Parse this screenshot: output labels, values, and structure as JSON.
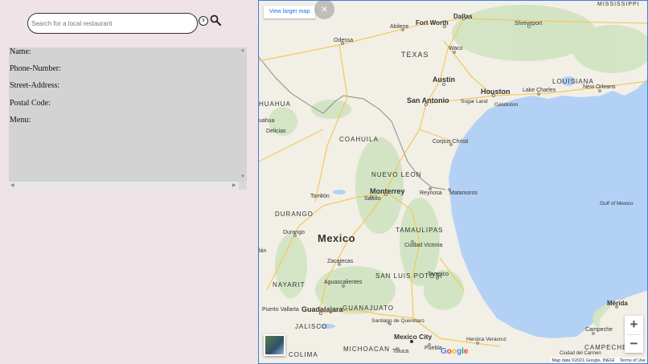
{
  "search": {
    "placeholder": "Search for a local restaurant",
    "value": "",
    "clear_label": "x"
  },
  "details": {
    "fields": [
      {
        "label": "Name:"
      },
      {
        "label": "Phone-Number:"
      },
      {
        "label": "Street-Address:"
      },
      {
        "label": "Postal Code:"
      },
      {
        "label": "Menu:"
      }
    ]
  },
  "map": {
    "view_larger": "View larger map",
    "close": "×",
    "zoom_in": "+",
    "zoom_out": "−",
    "attribution": "Map data ©2021 Google, INEGI",
    "terms": "Terms of Use",
    "google": [
      "G",
      "o",
      "o",
      "g",
      "l",
      "e"
    ],
    "google_colors": [
      "#4285f4",
      "#ea4335",
      "#fbbc05",
      "#4285f4",
      "#34a853",
      "#ea4335"
    ],
    "labels": {
      "mississippi": "MISSISSIPPI",
      "fort_worth": "Fort Worth",
      "dallas": "Dallas",
      "shreveport": "Shreveport",
      "abilene": "Abilene",
      "odessa": "Odessa",
      "texas": "TEXAS",
      "waco": "Waco",
      "louisiana": "LOUISIANA",
      "austin": "Austin",
      "houston": "Houston",
      "lake_charles": "Lake Charles",
      "new_orleans": "New Orleans",
      "sugar_land": "Sugar Land",
      "san_antonio": "San Antonio",
      "galveston": "Galveston",
      "chihuahua_state": "HUAHUA",
      "chihuahua_city": "uahua",
      "delicias": "Delicias",
      "coahuila": "COAHUILA",
      "corpus_christi": "Corpus Christi",
      "nuevo_leon": "NUEVO LEON",
      "monterrey": "Monterrey",
      "torreon": "Torreón",
      "saltillo": "Saltillo",
      "reynosa": "Reynosa",
      "matamoros": "Matamoros",
      "gulf": "Gulf of Mexico",
      "durango_state": "DURANGO",
      "durango_city": "Durango",
      "mexico": "Mexico",
      "tamaulipas": "TAMAULIPAS",
      "ciudad_victoria": "Ciudad Victoria",
      "zacatecas": "Zacatecas",
      "culiacan": "lán",
      "aguascalientes": "Aguascalientes",
      "san_luis_potosi": "SAN LUIS POTOSI",
      "tampico": "Tampico",
      "nayarit": "NAYARIT",
      "puerto_vallarta": "Puerto Vallarta",
      "guadalajara": "Guadalajara",
      "guanajuato": "GUANAJUATO",
      "jalisco": "JALISCO",
      "santiago": "Santiago de Querétaro",
      "merida": "Mérida",
      "campeche_city": "Campeche",
      "mexico_city": "Mexico City",
      "heroica": "Heroica Veracruz",
      "colima": "COLIMA",
      "michoacan": "MICHOACAN",
      "toluca": "Toluca",
      "puebla": "Puebla",
      "campeche_state": "CAMPECHE",
      "ciudad_del_carmen": "Ciudad del Carmen"
    }
  }
}
